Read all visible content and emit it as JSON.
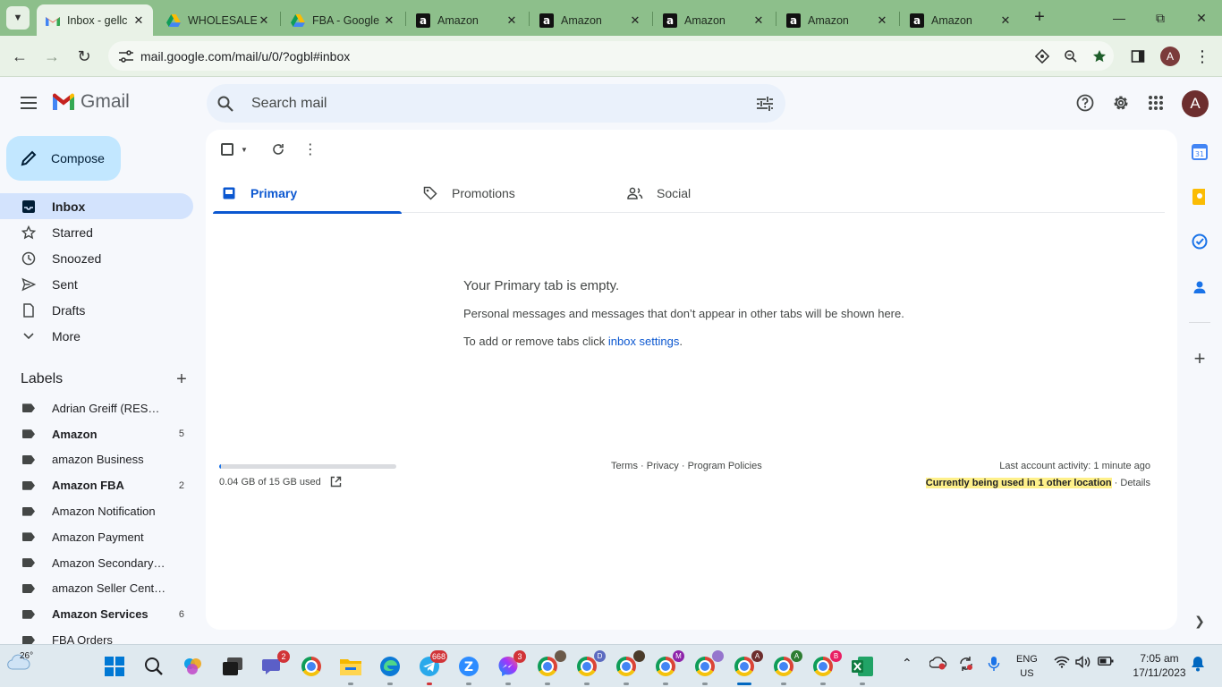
{
  "browser": {
    "tabs": [
      {
        "title": "Inbox - gellc",
        "favicon": "gmail-icon",
        "active": true
      },
      {
        "title": "WHOLESALE",
        "favicon": "google-drive-icon",
        "active": false
      },
      {
        "title": "FBA - Google",
        "favicon": "google-drive-icon",
        "active": false
      },
      {
        "title": "Amazon",
        "favicon": "amazon-icon",
        "active": false
      },
      {
        "title": "Amazon",
        "favicon": "amazon-icon",
        "active": false
      },
      {
        "title": "Amazon",
        "favicon": "amazon-icon",
        "active": false
      },
      {
        "title": "Amazon",
        "favicon": "amazon-icon",
        "active": false
      },
      {
        "title": "Amazon",
        "favicon": "amazon-icon",
        "active": false
      }
    ],
    "url": "mail.google.com/mail/u/0/?ogbl#inbox",
    "profile_initial": "A",
    "accent_color": "#8dbf8b"
  },
  "gmail": {
    "logo_text": "Gmail",
    "search_placeholder": "Search mail",
    "account_initial": "A",
    "compose_label": "Compose",
    "nav": [
      {
        "label": "Inbox",
        "icon": "inbox-icon",
        "active": true
      },
      {
        "label": "Starred",
        "icon": "star-icon",
        "active": false
      },
      {
        "label": "Snoozed",
        "icon": "clock-icon",
        "active": false
      },
      {
        "label": "Sent",
        "icon": "send-icon",
        "active": false
      },
      {
        "label": "Drafts",
        "icon": "draft-icon",
        "active": false
      },
      {
        "label": "More",
        "icon": "chevron-down-icon",
        "active": false
      }
    ],
    "labels_heading": "Labels",
    "labels": [
      {
        "name": "Adrian Greiff (RESALE C...",
        "count": "",
        "bold": false
      },
      {
        "name": "Amazon",
        "count": "5",
        "bold": true
      },
      {
        "name": "amazon Business",
        "count": "",
        "bold": false
      },
      {
        "name": "Amazon FBA",
        "count": "2",
        "bold": true
      },
      {
        "name": "Amazon Notification",
        "count": "",
        "bold": false
      },
      {
        "name": "Amazon Payment",
        "count": "",
        "bold": false
      },
      {
        "name": "Amazon Secondary Invit...",
        "count": "",
        "bold": false
      },
      {
        "name": "amazon Seller Central",
        "count": "",
        "bold": false
      },
      {
        "name": "Amazon Services",
        "count": "6",
        "bold": true
      },
      {
        "name": "FBA Orders",
        "count": "",
        "bold": false
      }
    ],
    "category_tabs": [
      {
        "label": "Primary",
        "icon": "inbox-tab-icon",
        "active": true
      },
      {
        "label": "Promotions",
        "icon": "tag-icon",
        "active": false
      },
      {
        "label": "Social",
        "icon": "people-icon",
        "active": false
      }
    ],
    "empty_state": {
      "title": "Your Primary tab is empty.",
      "description": "Personal messages and messages that don’t appear in other tabs will be shown here.",
      "settings_prefix": "To add or remove tabs click ",
      "settings_link": "inbox settings",
      "settings_suffix": "."
    },
    "storage": {
      "text": "0.04 GB of 15 GB used",
      "fraction_used": 0.003
    },
    "footer_links": [
      "Terms",
      "Privacy",
      "Program Policies"
    ],
    "activity": {
      "last": "Last account activity: 1 minute ago",
      "highlight": "Currently being used in 1 other location",
      "details": "Details"
    },
    "accent_color": "#0b57d0"
  },
  "taskbar": {
    "weather_temp": "26°",
    "language": "ENG",
    "region": "US",
    "time": "7:05 am",
    "date": "17/11/2023",
    "badges": {
      "teams": "2",
      "telegram": "668",
      "messenger": "3"
    }
  }
}
